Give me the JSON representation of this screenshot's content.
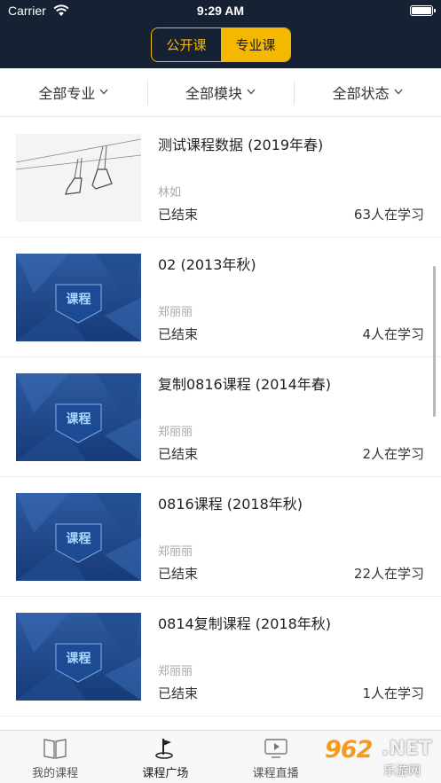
{
  "status_bar": {
    "carrier": "Carrier",
    "time": "9:29 AM"
  },
  "header": {
    "tabs": [
      {
        "label": "公开课",
        "active": false
      },
      {
        "label": "专业课",
        "active": true
      }
    ],
    "accent": "#f5b800",
    "background": "#162133"
  },
  "filters": [
    {
      "label": "全部专业"
    },
    {
      "label": "全部模块"
    },
    {
      "label": "全部状态"
    }
  ],
  "courses": [
    {
      "title": "测试课程数据 (2019年春)",
      "teacher": "林如",
      "status": "已结束",
      "learners": "63人在学习",
      "thumb": "photo"
    },
    {
      "title": "02 (2013年秋)",
      "teacher": "郑丽丽",
      "status": "已结束",
      "learners": "4人在学习",
      "thumb": "课程"
    },
    {
      "title": "复制0816课程 (2014年春)",
      "teacher": "郑丽丽",
      "status": "已结束",
      "learners": "2人在学习",
      "thumb": "课程"
    },
    {
      "title": "0816课程 (2018年秋)",
      "teacher": "郑丽丽",
      "status": "已结束",
      "learners": "22人在学习",
      "thumb": "课程"
    },
    {
      "title": "0814复制课程 (2018年秋)",
      "teacher": "郑丽丽",
      "status": "已结束",
      "learners": "1人在学习",
      "thumb": "课程"
    }
  ],
  "tabbar": [
    {
      "label": "我的课程",
      "icon": "book-icon",
      "active": false
    },
    {
      "label": "课程广场",
      "icon": "flag-icon",
      "active": true
    },
    {
      "label": "课程直播",
      "icon": "play-screen-icon",
      "active": false
    }
  ],
  "watermark": {
    "num": "962",
    "net": ".NET",
    "cn": "乐游网"
  }
}
